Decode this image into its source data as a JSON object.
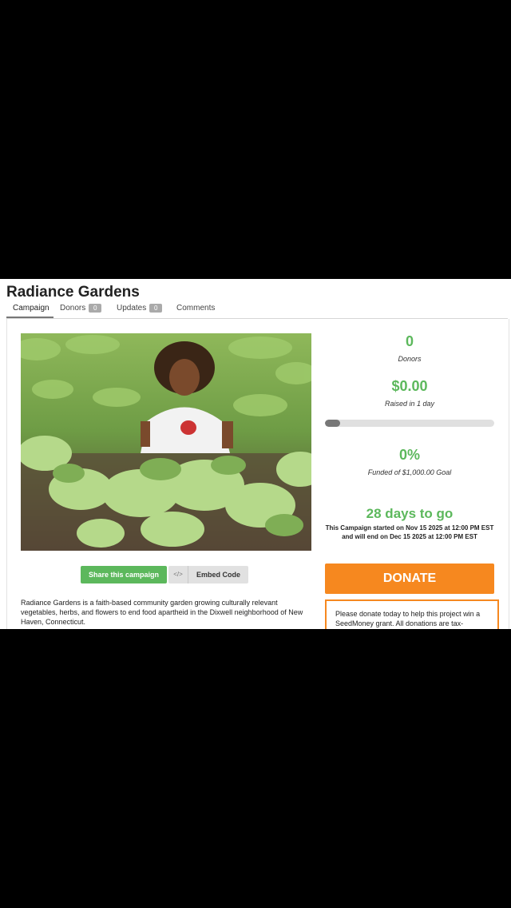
{
  "campaign": {
    "title": "Radiance Gardens"
  },
  "tabs": [
    {
      "label": "Campaign"
    },
    {
      "label": "Donors",
      "count": "0"
    },
    {
      "label": "Updates",
      "count": "0"
    },
    {
      "label": "Comments"
    }
  ],
  "stats": {
    "donors_value": "0",
    "donors_label": "Donors",
    "raised_value": "$0.00",
    "raised_label": "Raised in 1 day",
    "progress_fraction": 0.0,
    "funded_value": "0%",
    "funded_label": "Funded of $1,000.00 Goal",
    "days_left": "28 days to go",
    "dates_text": "This Campaign started on Nov 15 2025 at 12:00 PM EST and will end on Dec 15 2025 at 12:00 PM EST"
  },
  "actions": {
    "share_label": "Share this campaign",
    "embed_icon": "</>",
    "embed_label": "Embed Code",
    "donate_label": "DONATE"
  },
  "description": "Radiance Gardens is a faith-based community garden growing culturally relevant vegetables, herbs, and flowers to end food apartheid in the Dixwell neighborhood of New Haven, Connecticut.",
  "donate_note": "Please donate today to help this project win a SeedMoney grant. All donations are tax-",
  "colors": {
    "accent_green": "#5cb85c",
    "donate_orange": "#f6881f"
  }
}
